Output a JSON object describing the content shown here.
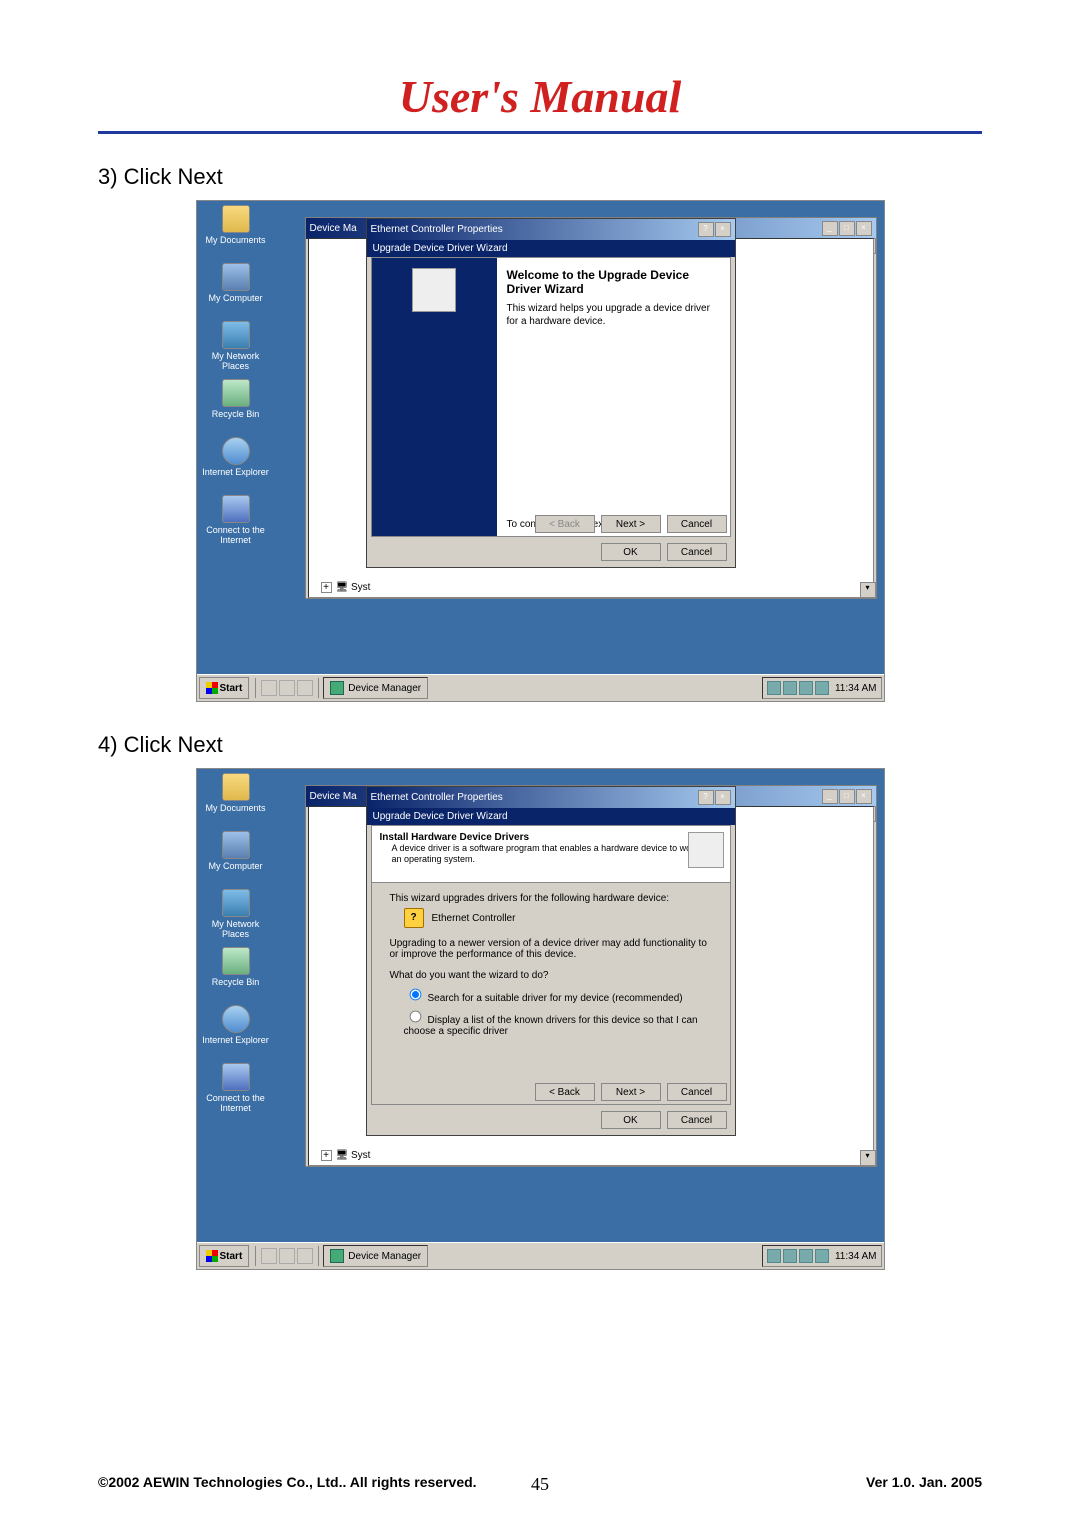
{
  "header": {
    "title": "User's Manual"
  },
  "steps": {
    "s3": "3) Click Next",
    "s4": "4) Click Next"
  },
  "desktop_icons": [
    {
      "name": "my-documents-icon",
      "label": "My Documents",
      "cls": "folder"
    },
    {
      "name": "my-computer-icon",
      "label": "My Computer",
      "cls": "computer"
    },
    {
      "name": "my-network-places-icon",
      "label": "My Network Places",
      "cls": "network"
    },
    {
      "name": "recycle-bin-icon",
      "label": "Recycle Bin",
      "cls": "recycle"
    },
    {
      "name": "internet-explorer-icon",
      "label": "Internet Explorer",
      "cls": "ie"
    },
    {
      "name": "connect-internet-icon",
      "label": "Connect to the Internet",
      "cls": "connect"
    }
  ],
  "dm": {
    "title_truncated": "Device Ma",
    "task_label": "Device Manager",
    "tree_item": "Syst"
  },
  "prop": {
    "title": "Ethernet Controller Properties",
    "wizard_tab": "Upgrade Device Driver Wizard"
  },
  "wizard1": {
    "heading": "Welcome to the Upgrade Device Driver Wizard",
    "sub": "This wizard helps you upgrade a device driver for a hardware device.",
    "continue": "To continue, click Next.",
    "back": "< Back",
    "next": "Next >",
    "cancel": "Cancel"
  },
  "wizard2": {
    "h2t": "Install Hardware Device Drivers",
    "h2d": "A device driver is a software program that enables a hardware device to work with an operating system.",
    "line1": "This wizard upgrades drivers for the following hardware device:",
    "device": "Ethernet Controller",
    "line2": "Upgrading to a newer version of a device driver may add functionality to or improve the performance of this device.",
    "q": "What do you want the wizard to do?",
    "opt1": "Search for a suitable driver for my device (recommended)",
    "opt2": "Display a list of the known drivers for this device so that I can choose a specific driver",
    "back": "< Back",
    "next": "Next >",
    "cancel": "Cancel"
  },
  "okcancel": {
    "ok": "OK",
    "cancel": "Cancel"
  },
  "taskbar": {
    "start": "Start",
    "clock": "11:34 AM"
  },
  "footer": {
    "copyright": "©2002 AEWIN Technologies Co., Ltd.. All rights reserved.",
    "page": "45",
    "version": "Ver 1.0. Jan. 2005"
  }
}
